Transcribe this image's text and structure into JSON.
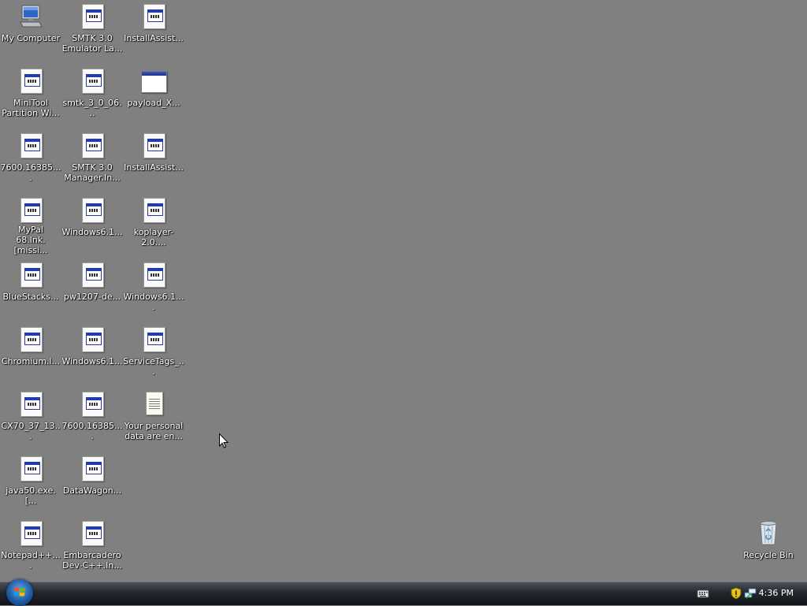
{
  "desktop": {
    "icons": [
      {
        "label": "My Computer",
        "type": "computer"
      },
      {
        "label": "SMTK 3.0\nEmulator La...",
        "type": "exe"
      },
      {
        "label": "InstallAssist...",
        "type": "exe"
      },
      {
        "label": "MiniTool\nPartition Wi...",
        "type": "exe"
      },
      {
        "label": "smtk_3_0_06...",
        "type": "exe"
      },
      {
        "label": "payload_X...",
        "type": "winapp"
      },
      {
        "label": "7600.16385....",
        "type": "exe"
      },
      {
        "label": "SMTK 3.0\nManager.In...",
        "type": "exe"
      },
      {
        "label": "InstallAssist...",
        "type": "exe"
      },
      {
        "label": "MyPal\n68.lnk.[missi...",
        "type": "exe"
      },
      {
        "label": "Windows6.1...",
        "type": "exe"
      },
      {
        "label": "koplayer-2.0....",
        "type": "exe"
      },
      {
        "label": "BlueStacks...",
        "type": "exe"
      },
      {
        "label": "pw1207-de...",
        "type": "exe"
      },
      {
        "label": "Windows6.1....",
        "type": "exe"
      },
      {
        "label": "Chromium.l...",
        "type": "exe"
      },
      {
        "label": "Windows6.1...",
        "type": "exe"
      },
      {
        "label": "ServiceTags_...",
        "type": "exe"
      },
      {
        "label": "CX70_37_13...",
        "type": "exe"
      },
      {
        "label": "7600.16385....",
        "type": "exe"
      },
      {
        "label": "Your personal\ndata are en...",
        "type": "text"
      },
      {
        "label": "java50.exe.[...",
        "type": "exe"
      },
      {
        "label": "DataWagon...",
        "type": "exe"
      },
      {
        "label": "Notepad++....",
        "type": "exe"
      },
      {
        "label": "Embarcadero\nDev-C++.In...",
        "type": "exe"
      },
      {
        "label": "Recycle Bin",
        "type": "bin"
      }
    ]
  },
  "taskbar": {
    "clock": "4:36 PM",
    "tray_icons": [
      "keyboard-icon",
      "shield-icon",
      "network-icon"
    ]
  },
  "colors": {
    "desktop_background": "#808080",
    "taskbar": "#23272d",
    "label_text": "#ffffff"
  }
}
